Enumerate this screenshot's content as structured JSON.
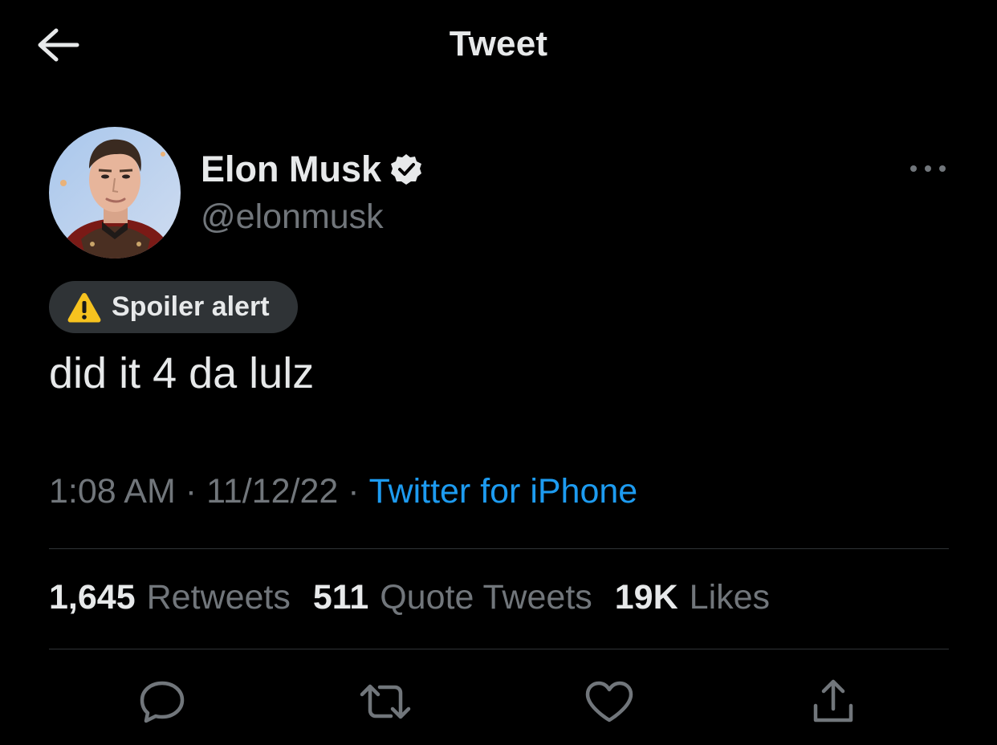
{
  "header": {
    "title": "Tweet",
    "back_icon": "arrow-left-icon"
  },
  "author": {
    "display_name": "Elon Musk",
    "handle": "@elonmusk",
    "verified_icon": "verified-badge-icon"
  },
  "spoiler": {
    "icon": "warning-icon",
    "label": "Spoiler alert"
  },
  "tweet": {
    "text": "did it 4 da lulz",
    "time": "1:08 AM",
    "date": "11/12/22",
    "separator": "·",
    "source": "Twitter for iPhone"
  },
  "stats": {
    "retweets_count": "1,645",
    "retweets_label": "Retweets",
    "quotes_count": "511",
    "quotes_label": "Quote Tweets",
    "likes_count": "19K",
    "likes_label": "Likes"
  },
  "actions": [
    {
      "name": "reply",
      "icon": "reply-bubble-icon"
    },
    {
      "name": "retweet",
      "icon": "retweet-icon"
    },
    {
      "name": "like",
      "icon": "heart-icon"
    },
    {
      "name": "share",
      "icon": "share-upload-icon"
    }
  ],
  "colors": {
    "background": "#000000",
    "text_primary": "#e7e9ea",
    "text_secondary": "#71767b",
    "link": "#1d9bf0",
    "divider": "#2f3336",
    "badge_bg": "#2f3336"
  }
}
